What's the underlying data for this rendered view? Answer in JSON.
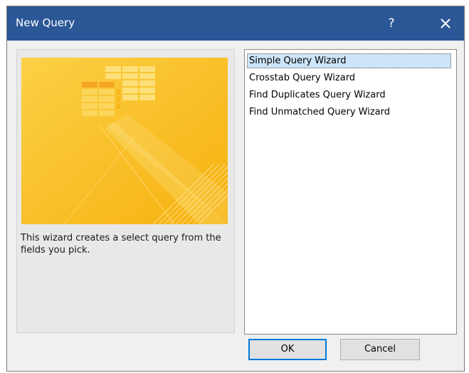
{
  "dialog": {
    "title": "New Query",
    "help_label": "?",
    "close_icon": "close-icon"
  },
  "preview": {
    "icon": "query-wizard-illustration",
    "colors": {
      "background": "#fbc21f",
      "grid_light": "#fde07a",
      "grid_dark": "#f5a623"
    },
    "description": "This wizard creates a select query from the fields you pick."
  },
  "wizards": {
    "selected_index": 0,
    "items": [
      {
        "label": "Simple Query Wizard"
      },
      {
        "label": "Crosstab Query Wizard"
      },
      {
        "label": "Find Duplicates Query Wizard"
      },
      {
        "label": "Find Unmatched Query Wizard"
      }
    ]
  },
  "buttons": {
    "ok_label": "OK",
    "cancel_label": "Cancel"
  },
  "colors": {
    "titlebar": "#2b5797",
    "dialog_bg": "#f0f0f0",
    "selection": "#cce4f7",
    "default_button_border": "#0078d7"
  }
}
